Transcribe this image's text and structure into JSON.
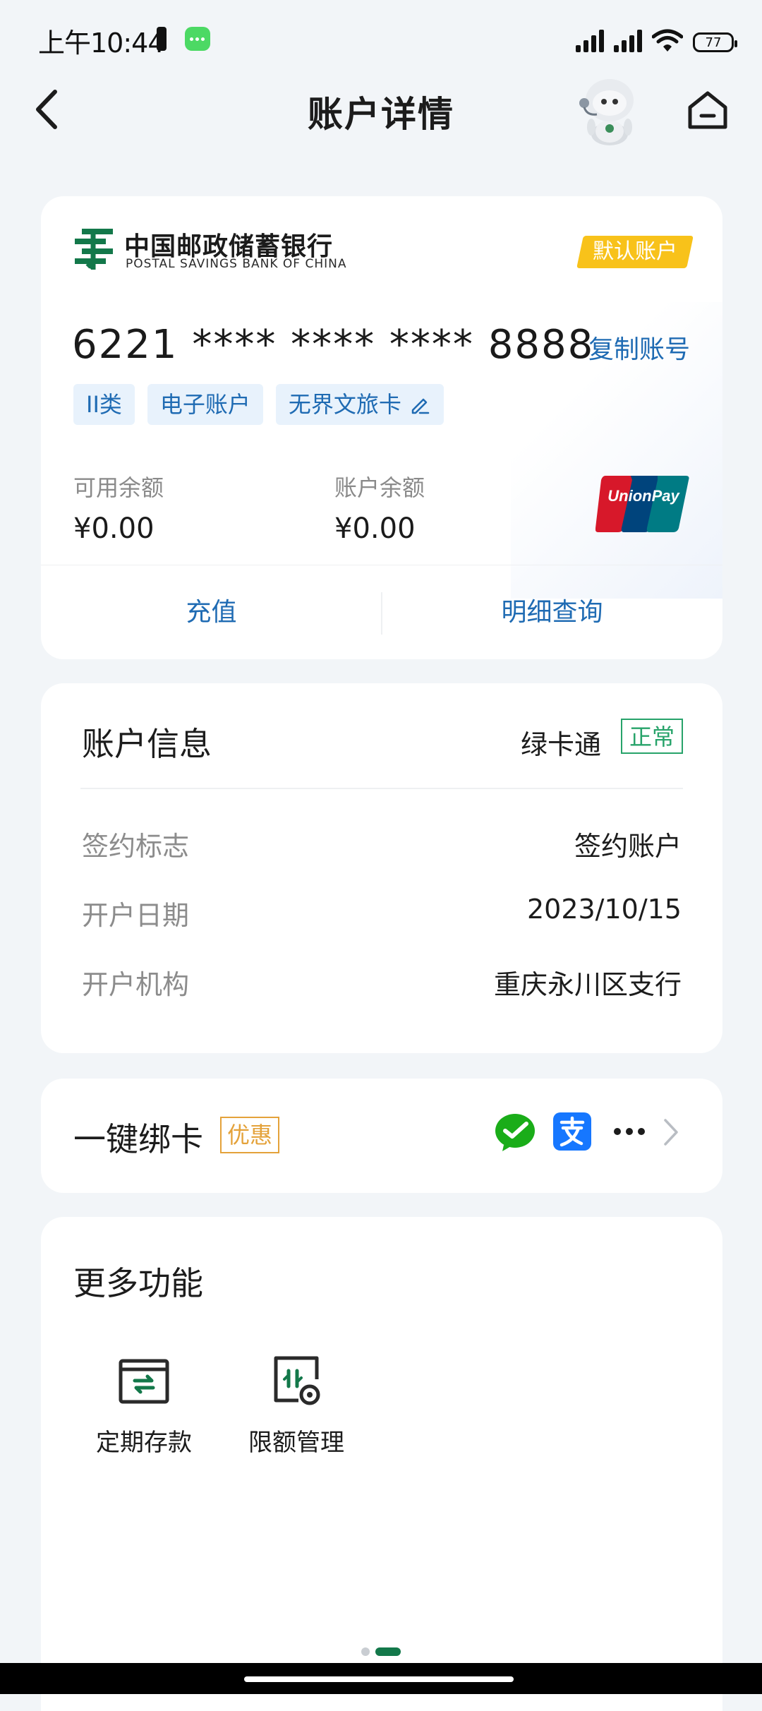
{
  "status_bar": {
    "time": "上午10:44",
    "battery": "77"
  },
  "header": {
    "title": "账户详情"
  },
  "account_card": {
    "bank_name_cn": "中国邮政储蓄银行",
    "bank_name_en": "POSTAL SAVINGS BANK OF CHINA",
    "default_badge": "默认账户",
    "card_number": "6221 **** **** **** 8888",
    "copy_label": "复制账号",
    "tags": [
      "II类",
      "电子账户",
      "无界文旅卡"
    ],
    "available_balance_label": "可用余额",
    "available_balance": "¥0.00",
    "account_balance_label": "账户余额",
    "account_balance": "¥0.00",
    "actions": [
      "充值",
      "明细查询"
    ]
  },
  "account_info": {
    "title": "账户信息",
    "card_type": "绿卡通",
    "status": "正常",
    "rows": [
      {
        "label": "签约标志",
        "value": "签约账户"
      },
      {
        "label": "开户日期",
        "value": "2023/10/15"
      },
      {
        "label": "开户机构",
        "value": "重庆永川区支行"
      }
    ]
  },
  "bind_card": {
    "title": "一键绑卡",
    "promo": "优惠"
  },
  "more_functions": {
    "title": "更多功能",
    "items": [
      {
        "label": "定期存款",
        "icon": "fixed-deposit-icon"
      },
      {
        "label": "限额管理",
        "icon": "limit-management-icon"
      }
    ],
    "page_count": 2,
    "active_page": 2
  },
  "colors": {
    "link_blue": "#1f6bb3",
    "status_green": "#27a36a",
    "promo_orange": "#e4a23a",
    "badge_yellow": "#f8c21a",
    "bank_green": "#13784a"
  }
}
